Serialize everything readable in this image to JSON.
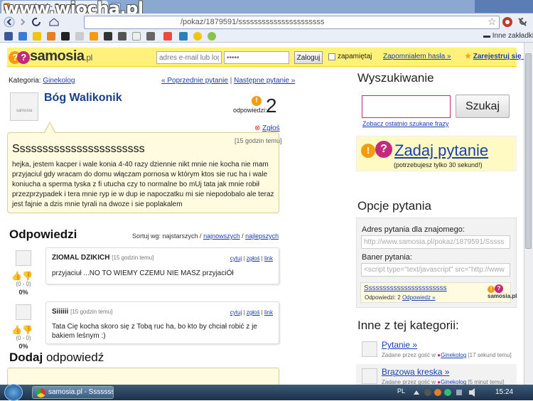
{
  "browser": {
    "tab_title": "samosia.pl - Ssssssssss...",
    "url_visible": "/pokaz/1879591/ssssssssssssssssssssss",
    "bookmarks_folder": "Inne zakładki",
    "watermark": "www.wiocha.pl"
  },
  "header": {
    "logo_text": "samosia",
    "logo_tld": ".pl",
    "email_placeholder": "adres e-mail lub login",
    "password_value": "•••••",
    "login_button": "Zaloguj",
    "remember_label": "zapamiętaj",
    "forgot_link": "Zapomniałem hasła »",
    "register_link": "Zarejestruj się »"
  },
  "question": {
    "category_label": "Kategoria:",
    "category": "Ginekolog",
    "prev_link": "« Poprzednie pytanie",
    "separator": "|",
    "next_link": "Następne pytanie »",
    "author": "Bóg Walikonik",
    "answers_label": "odpowiedzi:",
    "answers_count": "2",
    "report_link": "Zgłoś",
    "time": "[15 godzin temu]",
    "title": "Sssssssssssssssssssssss",
    "body": "hejka, jestem kacper i wale konia 4-40 razy dziennie nikt mnie nie kocha nie mam przyjaciul gdy wracam do domu włączam pornosa w którym ktos sie ruc ha i wale koniucha a sperma tyska z fi utucha czy to normalne bo mUj tata jak mnie robił przezprzypadek i tera mnie ryp ie w dup ie napoczatku mi sie niepodobalo ale teraz jest fajnie a dzis mnie tyrali na dwoze i sie poplakalem"
  },
  "answers_section": {
    "heading": "Odpowiedzi",
    "sort_label": "Sortuj wg: najstarszych /",
    "sort_newest": "najnowszych",
    "sort_sep": "/",
    "sort_best": "najlepszych",
    "items": [
      {
        "author": "ZIOMAL DZIKICH",
        "time": "[15 godzin temu]",
        "quote": "cytuj",
        "report": "zgłoś",
        "link": "link",
        "text": "przyjaciuł ...NO TO WIEMY CZEMU NIE MASZ przyjaciÓł",
        "score": "(0 - 0)",
        "percent": "0%"
      },
      {
        "author": "Siiiiii",
        "time": "[15 godzin temu]",
        "quote": "cytuj",
        "report": "zgłoś",
        "link": "link",
        "text": "Tata Cię kocha skoro się z Tobą ruc ha, bo kto by chciał robić z je bakiem leśnym :)",
        "score": "(0 - 0)",
        "percent": "0%"
      }
    ],
    "add_heading_bold": "Dodaj",
    "add_heading_rest": " odpowiedź"
  },
  "sidebar": {
    "search_heading": "Wyszukiwanie",
    "search_button": "Szukaj",
    "last_searches": "Zobacz ostatnio szukane frazy",
    "ask_link": "Zadaj pytanie",
    "ask_sub": "(potrzebujesz tylko 30 sekund!)",
    "options_heading": "Opcje pytania",
    "address_label": "Adres pytania dla znajomego:",
    "address_value": "http://www.samosia.pl/pokaz/1879591/Sssss",
    "banner_label": "Baner pytania:",
    "banner_value": "<script type=\"text/javascript\" src=\"http://www",
    "banner_title": "Sssssssssssssssssssssss",
    "banner_answers": "Odpowiedzi: 2",
    "banner_answers_link": "Odpowiedz »",
    "banner_logo": "samosia.pl",
    "other_heading": "Inne z tej kategorii:",
    "other": [
      {
        "title": "Pytanie »",
        "meta_prefix": "Zadane przez gość w",
        "cat": "Ginekolog",
        "time": "[17 sekund temu]"
      },
      {
        "title": "Brązowa kreska »",
        "meta_prefix": "Zadane przez gość w",
        "cat": "Ginekolog",
        "time": "[5 minut temu]"
      }
    ]
  },
  "taskbar": {
    "task_label": "samosia.pl - Sssssss...",
    "lang": "PL",
    "clock": "15:24"
  },
  "colors": {
    "header_yellow": "#fff17a",
    "link_blue": "#1a3fb3",
    "accent_magenta": "#c42a7b",
    "logo_orange": "#f39c12"
  }
}
